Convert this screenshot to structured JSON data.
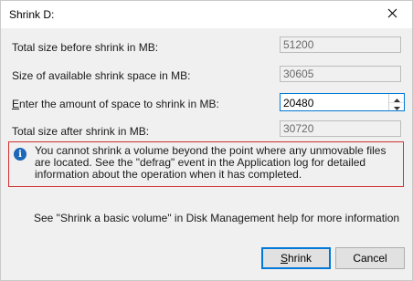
{
  "window": {
    "title": "Shrink D:",
    "close_glyph": "✕"
  },
  "fields": {
    "total_before_label": "Total size before shrink in MB:",
    "total_before_value": "51200",
    "available_label": "Size of available shrink space in MB:",
    "available_value": "30605",
    "amount_label_prefix": "E",
    "amount_label_rest": "nter the amount of space to shrink in MB:",
    "amount_value": "20480",
    "total_after_label": "Total size after shrink in MB:",
    "total_after_value": "30720"
  },
  "info": {
    "icon": "info-icon",
    "text": "You cannot shrink a volume beyond the point where any unmovable files are located. See the \"defrag\" event in the Application log for detailed information about the operation when it has completed."
  },
  "help": {
    "text": "See \"Shrink a basic volume\" in Disk Management help for more information"
  },
  "buttons": {
    "shrink_mnemonic": "S",
    "shrink_rest": "hrink",
    "cancel_label": "Cancel"
  },
  "colors": {
    "focus_border": "#0078d7",
    "info_border": "#d12f2f",
    "info_icon": "#1d67b8"
  }
}
